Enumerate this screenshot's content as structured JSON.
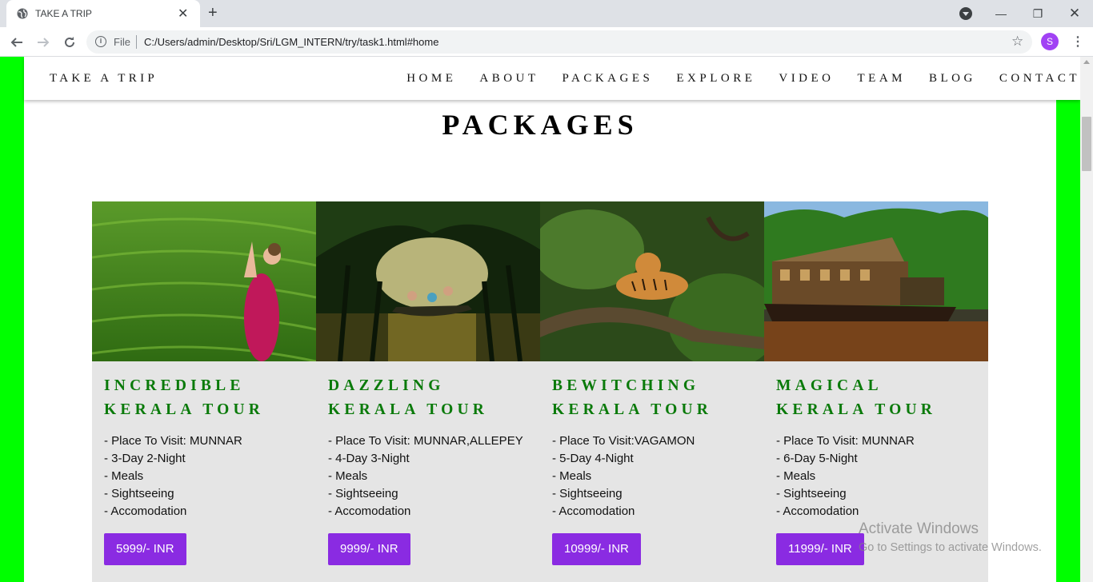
{
  "browser": {
    "tab_title": "TAKE A TRIP",
    "url_scheme": "File",
    "url": "C:/Users/admin/Desktop/Sri/LGM_INTERN/try/task1.html#home",
    "profile_initial": "S"
  },
  "site": {
    "brand": "TAKE A TRIP",
    "nav": [
      "HOME",
      "ABOUT",
      "PACKAGES",
      "EXPLORE",
      "VIDEO",
      "TEAM",
      "BLOG",
      "CONTACT"
    ],
    "section_title": "PACKAGES",
    "packages": [
      {
        "title": "INCREDIBLE\nKERALA TOUR",
        "details": [
          "- Place To Visit: MUNNAR",
          "- 3-Day 2-Night",
          "- Meals",
          "- Sightseeing",
          "- Accomodation"
        ],
        "price": "5999/- INR"
      },
      {
        "title": "DAZZLING\nKERALA TOUR",
        "details": [
          "- Place To Visit: MUNNAR,ALLEPEY",
          "- 4-Day 3-Night",
          "- Meals",
          "- Sightseeing",
          "- Accomodation"
        ],
        "price": "9999/- INR"
      },
      {
        "title": "BEWITCHING\nKERALA TOUR",
        "details": [
          "- Place To Visit:VAGAMON",
          "- 5-Day 4-Night",
          "- Meals",
          "- Sightseeing",
          "- Accomodation"
        ],
        "price": "10999/- INR"
      },
      {
        "title": "MAGICAL\nKERALA TOUR",
        "details": [
          "- Place To Visit: MUNNAR",
          "- 6-Day 5-Night",
          "- Meals",
          "- Sightseeing",
          "- Accomodation"
        ],
        "price": "11999/- INR"
      }
    ]
  },
  "watermark": {
    "line1": "Activate Windows",
    "line2": "Go to Settings to activate Windows."
  },
  "colors": {
    "page_border": "#00ff00",
    "title_green": "#0a7a0a",
    "price_button": "#8a2be2",
    "card_bg": "#e5e5e5"
  }
}
